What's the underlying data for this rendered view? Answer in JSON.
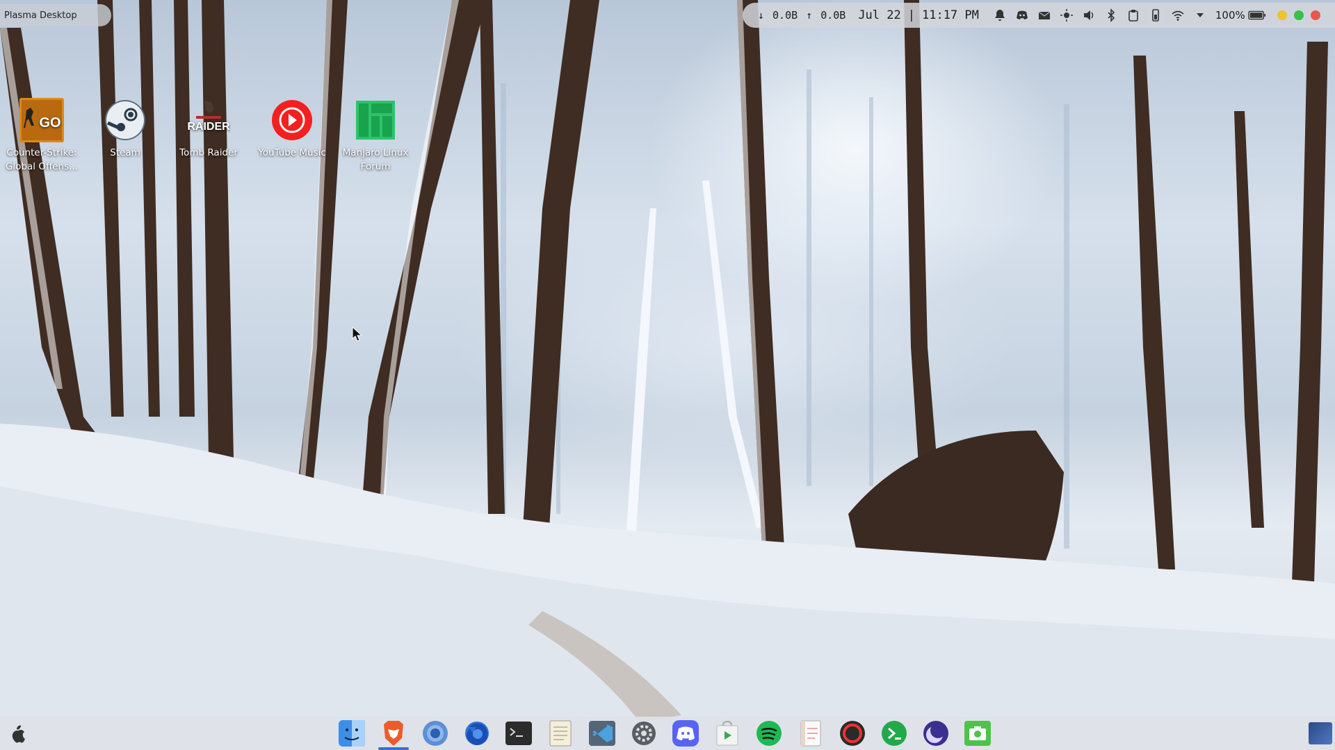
{
  "window": {
    "title": "Plasma Desktop"
  },
  "panel": {
    "net_down": "↓",
    "net_down_value": "0.0B",
    "net_up": "↑",
    "net_up_value": "0.0B",
    "date": "Jul 22",
    "separator": "|",
    "time": "11:17 PM",
    "battery": "100%",
    "tray_icons": [
      "notifications-icon",
      "discord-tray-icon",
      "mail-icon",
      "brightness-icon",
      "volume-icon",
      "bluetooth-icon",
      "clipboard-icon",
      "battery-monitor-icon",
      "wifi-icon",
      "expand-arrow-icon"
    ],
    "window_buttons": [
      "#f2c12e",
      "#35c14a",
      "#e8574e"
    ]
  },
  "desktop_icons": [
    {
      "id": "csgo",
      "label": "Counter-Strike: Global Offens...",
      "icon": "csgo-icon"
    },
    {
      "id": "steam",
      "label": "Steam",
      "icon": "steam-icon"
    },
    {
      "id": "tombraider",
      "label": "Tomb Raider",
      "icon": "tomb-raider-icon"
    },
    {
      "id": "ytmusic",
      "label": "YouTube Music",
      "icon": "youtube-music-icon"
    },
    {
      "id": "manjaro",
      "label": "Manjaro Linux Forum",
      "icon": "manjaro-icon"
    }
  ],
  "csgo_badge": "GO",
  "tomb_raider_badge": "RAIDER",
  "dock": {
    "launcher_icon": "apple-icon",
    "apps": [
      {
        "name": "finder",
        "icon": "finder-icon"
      },
      {
        "name": "brave",
        "icon": "brave-icon",
        "active": true
      },
      {
        "name": "chromium",
        "icon": "chromium-icon"
      },
      {
        "name": "firefox",
        "icon": "firefox-icon"
      },
      {
        "name": "terminal",
        "icon": "terminal-icon"
      },
      {
        "name": "text-editor",
        "icon": "text-editor-icon"
      },
      {
        "name": "vscode",
        "icon": "vscode-icon"
      },
      {
        "name": "system-settings",
        "icon": "settings-icon"
      },
      {
        "name": "discord",
        "icon": "discord-icon"
      },
      {
        "name": "software-store",
        "icon": "store-icon"
      },
      {
        "name": "spotify",
        "icon": "spotify-icon"
      },
      {
        "name": "notes",
        "icon": "notes-icon"
      },
      {
        "name": "recorder",
        "icon": "record-icon"
      },
      {
        "name": "console",
        "icon": "console-icon"
      },
      {
        "name": "night-mode",
        "icon": "moon-icon"
      },
      {
        "name": "screenshot",
        "icon": "camera-icon"
      }
    ]
  }
}
